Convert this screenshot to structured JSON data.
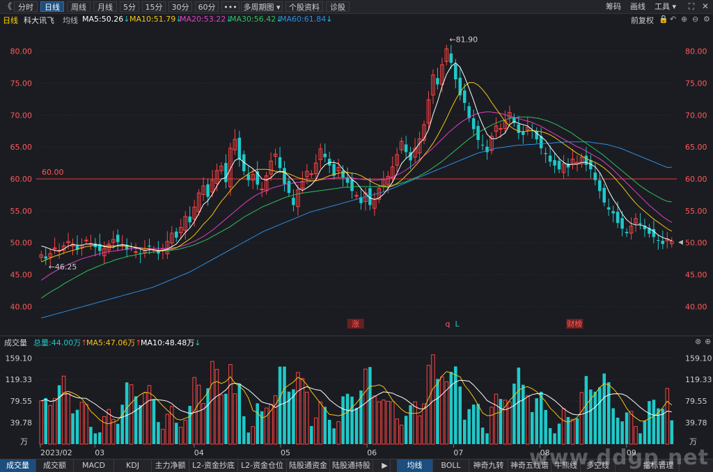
{
  "toolbar": {
    "back": "《",
    "tabs": [
      {
        "label": "分时",
        "active": false
      },
      {
        "label": "日线",
        "active": true
      },
      {
        "label": "周线",
        "active": false
      },
      {
        "label": "月线",
        "active": false
      },
      {
        "label": "5分",
        "active": false
      },
      {
        "label": "15分",
        "active": false
      },
      {
        "label": "30分",
        "active": false
      },
      {
        "label": "60分",
        "active": false
      },
      {
        "label": "•••",
        "active": false
      },
      {
        "label": "多周期图 ▾",
        "active": false
      },
      {
        "label": "个股资料",
        "active": false
      },
      {
        "label": "诊股",
        "active": false
      }
    ],
    "right": [
      "筹码",
      "画线",
      "工具 ▾"
    ]
  },
  "info": {
    "period": "日线",
    "name": "科大讯飞",
    "line_type": "均线",
    "ma5": "MA5:50.26",
    "ma10": "MA10:51.79",
    "ma20": "MA20:53.22",
    "ma30": "MA30:56.42",
    "ma60": "MA60:61.84",
    "down_arrow": "↓",
    "adjust": "前复权"
  },
  "price_axis": {
    "ticks": [
      "80.00",
      "75.00",
      "70.00",
      "65.00",
      "60.00",
      "55.00",
      "50.00",
      "45.00",
      "40.00"
    ],
    "ref_line": "60.00",
    "high_label": "81.90",
    "low_label": "46.25"
  },
  "markers": {
    "zhang": "涨",
    "q": "q",
    "l": "L",
    "report": "财榜"
  },
  "volume": {
    "title": "成交量",
    "total": "总量:44.00万",
    "ma5": "MA5:47.06万",
    "ma10": "MA10:48.48万",
    "up_arrow": "↑",
    "down_arrow": "↓",
    "ticks": [
      "159.10",
      "119.33",
      "79.55",
      "39.78"
    ],
    "unit": "万"
  },
  "dates": [
    "2023/02",
    "03",
    "04",
    "05",
    "06",
    "07",
    "08",
    "09"
  ],
  "bottom_tabs_left": [
    "成交量",
    "成交额",
    "MACD",
    "KDJ",
    "主力净额",
    "L2-资金抄底",
    "L2-资金仓位",
    "陆股通资金",
    "陆股通持股"
  ],
  "bottom_tabs_right": [
    "均线",
    "BOLL",
    "神奇九转",
    "神奇五线谱",
    "牛熊线",
    "多空线",
    "指标管理"
  ],
  "watermark": "www.ddgp.net",
  "colors": {
    "up": "#ff4444",
    "down": "#1fc9c9",
    "ma5": "#ffffff",
    "ma10": "#f5c518",
    "ma20": "#e040c8",
    "ma30": "#2fc060",
    "ma60": "#2b8fe8",
    "ref": "#e04040",
    "bg": "#1b1c21"
  },
  "chart_data": {
    "type": "candlestick",
    "title": "",
    "x_labels": [
      "2023/02",
      "03",
      "04",
      "05",
      "06",
      "07",
      "08",
      "09"
    ],
    "ylim": [
      36,
      84
    ],
    "ref_line": 60.0,
    "high": 81.9,
    "low": 46.25,
    "close_series": [
      48.1,
      47.5,
      48.3,
      49.2,
      48.8,
      49.5,
      50.2,
      49.8,
      48.9,
      49.6,
      50.4,
      49.9,
      49.3,
      48.7,
      49.1,
      49.8,
      50.5,
      50.1,
      49.6,
      48.9,
      49.3,
      48.6,
      48.2,
      48.8,
      49.4,
      48.9,
      48.3,
      49.0,
      50.2,
      51.5,
      50.8,
      52.4,
      54.1,
      53.2,
      55.6,
      57.8,
      58.9,
      57.2,
      59.8,
      61.3,
      62.0,
      59.5,
      64.8,
      66.2,
      63.1,
      61.2,
      59.8,
      60.7,
      59.1,
      58.4,
      60.5,
      62.8,
      63.9,
      61.7,
      59.2,
      57.8,
      55.9,
      58.3,
      59.6,
      61.2,
      60.8,
      62.5,
      64.7,
      63.4,
      62.1,
      60.5,
      61.8,
      60.2,
      59.4,
      58.1,
      57.4,
      56.2,
      57.8,
      55.9,
      56.8,
      58.5,
      59.9,
      60.4,
      61.9,
      63.8,
      65.9,
      64.2,
      62.9,
      64.8,
      66.3,
      68.5,
      72.4,
      76.3,
      74.8,
      77.9,
      80.4,
      78.2,
      75.6,
      73.1,
      71.9,
      69.5,
      67.8,
      66.1,
      65.3,
      64.2,
      66.7,
      68.3,
      67.9,
      69.1,
      70.4,
      68.8,
      67.2,
      66.9,
      68.1,
      67.5,
      66.2,
      64.8,
      63.9,
      62.7,
      62.1,
      61.5,
      62.4,
      61.8,
      63.1,
      62.6,
      63.4,
      62.2,
      61.5,
      59.8,
      58.1,
      56.3,
      55.2,
      54.6,
      53.1,
      52.2,
      51.5,
      52.6,
      53.8,
      52.9,
      52.1,
      51.4,
      50.9,
      50.3,
      49.8,
      50.6,
      50.26
    ],
    "ma5": [
      49.5,
      49.3,
      49.0,
      48.8,
      48.7,
      49.0,
      49.5,
      49.7,
      49.6,
      49.6,
      49.8,
      49.8,
      49.7,
      49.6,
      49.4,
      49.3,
      49.3,
      49.6,
      49.7,
      49.6,
      49.4,
      49.2,
      49.0,
      48.8,
      48.9,
      48.9,
      48.7,
      48.8,
      49.0,
      49.4,
      49.8,
      50.7,
      51.6,
      52.3,
      53.3,
      54.6,
      56.0,
      56.6,
      57.6,
      58.9,
      60.0,
      60.2,
      61.6,
      62.9,
      63.2,
      62.6,
      62.1,
      61.6,
      60.9,
      60.0,
      59.8,
      60.2,
      60.9,
      61.2,
      61.1,
      60.4,
      59.7,
      58.6,
      58.2,
      58.6,
      59.1,
      59.9,
      61.4,
      62.2,
      62.6,
      62.6,
      62.4,
      61.5,
      60.8,
      59.9,
      59.4,
      58.5,
      57.7,
      57.0,
      56.8,
      57.0,
      57.6,
      58.5,
      59.5,
      60.9,
      62.4,
      63.2,
      63.8,
      64.6,
      65.6,
      66.3,
      67.7,
      70.1,
      72.1,
      74.5,
      76.4,
      77.6,
      78.2,
      77.5,
      76.0,
      74.2,
      72.3,
      70.2,
      68.5,
      67.0,
      66.3,
      66.3,
      66.7,
      67.2,
      68.5,
      69.0,
      68.7,
      68.5,
      68.3,
      67.7,
      67.2,
      66.6,
      66.0,
      65.0,
      64.1,
      63.2,
      62.6,
      62.2,
      62.3,
      62.3,
      62.6,
      62.6,
      62.3,
      61.9,
      61.0,
      59.7,
      58.1,
      56.8,
      55.8,
      54.5,
      53.6,
      53.0,
      52.8,
      52.8,
      52.6,
      52.2,
      51.8,
      51.2,
      50.8,
      50.6,
      50.3
    ],
    "ma10": [
      47.0,
      47.3,
      47.6,
      47.9,
      48.1,
      48.4,
      48.6,
      48.8,
      49.0,
      49.2,
      49.4,
      49.5,
      49.6,
      49.6,
      49.5,
      49.5,
      49.5,
      49.5,
      49.5,
      49.5,
      49.4,
      49.3,
      49.2,
      49.1,
      49.0,
      48.9,
      48.8,
      48.8,
      48.9,
      49.0,
      49.2,
      49.6,
      50.1,
      50.6,
      51.2,
      52.0,
      52.9,
      53.6,
      54.4,
      55.5,
      56.5,
      57.3,
      58.2,
      59.0,
      59.8,
      60.3,
      60.8,
      61.2,
      61.5,
      61.5,
      61.5,
      61.4,
      61.2,
      61.1,
      61.0,
      60.8,
      60.5,
      60.2,
      60.0,
      59.8,
      59.7,
      59.7,
      59.9,
      60.2,
      60.5,
      60.7,
      60.9,
      61.0,
      61.0,
      60.9,
      60.8,
      60.5,
      60.1,
      59.7,
      59.3,
      59.0,
      58.8,
      58.7,
      58.9,
      59.3,
      59.8,
      60.5,
      61.2,
      62.0,
      62.8,
      63.7,
      64.6,
      65.6,
      66.8,
      68.1,
      69.5,
      71.0,
      72.4,
      73.6,
      74.5,
      75.1,
      75.1,
      74.7,
      74.0,
      73.1,
      72.0,
      71.0,
      70.0,
      69.0,
      68.3,
      67.8,
      67.5,
      67.4,
      67.5,
      67.6,
      67.5,
      67.4,
      67.2,
      66.9,
      66.5,
      66.0,
      65.5,
      65.0,
      64.5,
      64.0,
      63.6,
      63.2,
      62.9,
      62.6,
      62.2,
      61.7,
      61.1,
      60.4,
      59.6,
      58.8,
      57.9,
      57.0,
      56.2,
      55.5,
      54.9,
      54.3,
      53.7,
      53.2,
      52.7,
      52.2,
      51.8
    ],
    "ma20": [
      44.1,
      44.6,
      45.1,
      45.5,
      45.9,
      46.3,
      46.6,
      46.9,
      47.2,
      47.5,
      47.7,
      47.9,
      48.1,
      48.3,
      48.5,
      48.6,
      48.7,
      48.8,
      48.9,
      49.0,
      49.1,
      49.1,
      49.1,
      49.1,
      49.1,
      49.1,
      49.1,
      49.1,
      49.1,
      49.2,
      49.3,
      49.5,
      49.7,
      50.0,
      50.3,
      50.7,
      51.1,
      51.6,
      52.1,
      52.7,
      53.3,
      53.9,
      54.5,
      55.1,
      55.7,
      56.3,
      56.8,
      57.3,
      57.7,
      58.0,
      58.3,
      58.6,
      58.8,
      59.0,
      59.2,
      59.3,
      59.4,
      59.5,
      59.6,
      59.6,
      59.7,
      59.8,
      59.9,
      60.0,
      60.1,
      60.2,
      60.2,
      60.2,
      60.2,
      60.1,
      60.0,
      59.9,
      59.9,
      59.8,
      59.8,
      59.9,
      60.0,
      60.2,
      60.5,
      60.8,
      61.2,
      61.7,
      62.2,
      62.8,
      63.4,
      64.0,
      64.6,
      65.3,
      66.0,
      66.7,
      67.4,
      68.0,
      68.6,
      69.1,
      69.5,
      69.9,
      70.2,
      70.4,
      70.5,
      70.5,
      70.4,
      70.3,
      70.1,
      69.9,
      69.7,
      69.5,
      69.3,
      69.1,
      68.9,
      68.6,
      68.3,
      67.9,
      67.5,
      67.1,
      66.7,
      66.3,
      65.9,
      65.5,
      65.1,
      64.8,
      64.4,
      64.0,
      63.6,
      63.2,
      62.7,
      62.1,
      61.5,
      60.8,
      60.1,
      59.4,
      58.7,
      58.0,
      57.3,
      56.6,
      55.9,
      55.3,
      54.7,
      54.1,
      53.6,
      53.2
    ],
    "ma30": [
      41.3,
      41.8,
      42.3,
      42.7,
      43.1,
      43.6,
      44.0,
      44.4,
      44.8,
      45.2,
      45.6,
      45.9,
      46.2,
      46.5,
      46.8,
      47.0,
      47.3,
      47.5,
      47.7,
      47.9,
      48.0,
      48.2,
      48.3,
      48.4,
      48.5,
      48.6,
      48.7,
      48.7,
      48.8,
      48.9,
      49.0,
      49.2,
      49.4,
      49.6,
      49.9,
      50.2,
      50.5,
      50.9,
      51.3,
      51.7,
      52.1,
      52.5,
      53.0,
      53.5,
      54.0,
      54.4,
      54.8,
      55.2,
      55.6,
      55.9,
      56.2,
      56.5,
      56.8,
      57.1,
      57.3,
      57.5,
      57.7,
      57.8,
      57.9,
      58.0,
      58.1,
      58.2,
      58.3,
      58.4,
      58.5,
      58.6,
      58.7,
      58.7,
      58.8,
      58.8,
      58.8,
      58.8,
      58.8,
      58.8,
      58.8,
      58.9,
      59.0,
      59.1,
      59.3,
      59.5,
      59.8,
      60.1,
      60.4,
      60.8,
      61.2,
      61.7,
      62.2,
      62.7,
      63.3,
      63.9,
      64.5,
      65.1,
      65.7,
      66.3,
      66.8,
      67.3,
      67.7,
      68.1,
      68.5,
      68.8,
      69.1,
      69.3,
      69.5,
      69.6,
      69.7,
      69.7,
      69.7,
      69.6,
      69.5,
      69.3,
      69.1,
      68.8,
      68.5,
      68.1,
      67.7,
      67.3,
      66.8,
      66.3,
      65.8,
      65.3,
      64.8,
      64.3,
      63.8,
      63.2,
      62.6,
      62.0,
      61.4,
      60.8,
      60.2,
      59.6,
      59.0,
      58.5,
      58.0,
      57.6,
      57.2,
      56.8,
      56.5,
      56.4
    ],
    "ma60": [
      38.2,
      38.4,
      38.6,
      38.8,
      39.0,
      39.2,
      39.4,
      39.6,
      39.8,
      40.0,
      40.2,
      40.4,
      40.6,
      40.8,
      41.0,
      41.2,
      41.4,
      41.6,
      41.8,
      42.0,
      42.2,
      42.4,
      42.6,
      42.8,
      43.0,
      43.3,
      43.6,
      43.9,
      44.2,
      44.5,
      44.8,
      45.1,
      45.4,
      45.8,
      46.2,
      46.6,
      47.0,
      47.4,
      47.8,
      48.2,
      48.6,
      49.0,
      49.4,
      49.8,
      50.2,
      50.6,
      51.0,
      51.4,
      51.8,
      52.1,
      52.4,
      52.7,
      53.0,
      53.3,
      53.6,
      53.9,
      54.2,
      54.5,
      54.8,
      55.0,
      55.2,
      55.4,
      55.6,
      55.8,
      56.0,
      56.2,
      56.4,
      56.6,
      56.8,
      57.0,
      57.2,
      57.4,
      57.6,
      57.8,
      58.0,
      58.3,
      58.6,
      58.9,
      59.2,
      59.5,
      59.8,
      60.1,
      60.4,
      60.7,
      61.0,
      61.3,
      61.6,
      61.9,
      62.2,
      62.5,
      62.8,
      63.1,
      63.4,
      63.7,
      64.0,
      64.2,
      64.4,
      64.6,
      64.8,
      64.9,
      65.0,
      65.1,
      65.2,
      65.3,
      65.3,
      65.4,
      65.4,
      65.5,
      65.5,
      65.6,
      65.6,
      65.7,
      65.7,
      65.8,
      65.8,
      65.8,
      65.8,
      65.8,
      65.8,
      65.7,
      65.6,
      65.5,
      65.4,
      65.2,
      65.0,
      64.8,
      64.5,
      64.2,
      63.9,
      63.6,
      63.3,
      63.0,
      62.7,
      62.4,
      62.1,
      61.8,
      61.84
    ],
    "volume_ylim": [
      0,
      180
    ],
    "volume_ticks": [
      159.1,
      119.33,
      79.55,
      39.78
    ],
    "volume_total": 44.0
  }
}
